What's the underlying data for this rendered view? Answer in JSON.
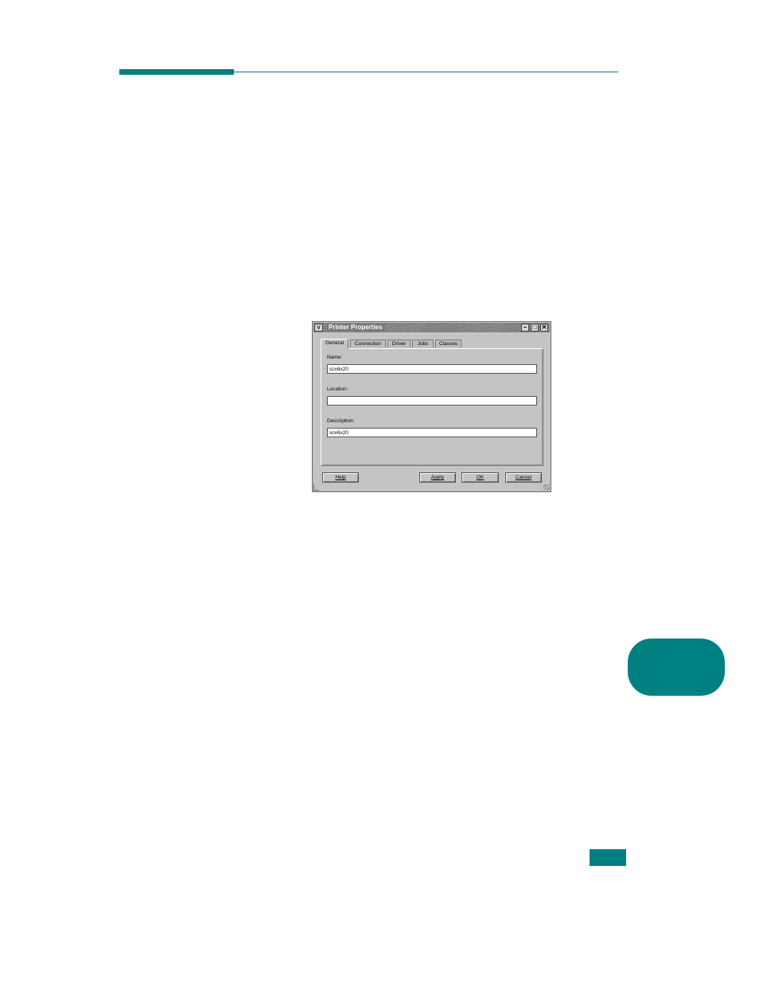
{
  "page": {
    "accent_color": "#008080"
  },
  "dialog": {
    "title": "Printer Properties",
    "window_menu_icon": "chevron-down-icon",
    "minimize_icon": "minimize-icon",
    "maximize_icon": "maximize-icon",
    "close_icon": "close-icon",
    "tabs": [
      {
        "label": "General",
        "active": true
      },
      {
        "label": "Connection",
        "active": false
      },
      {
        "label": "Driver",
        "active": false
      },
      {
        "label": "Jobs",
        "active": false
      },
      {
        "label": "Classes",
        "active": false
      }
    ],
    "fields": {
      "name": {
        "label": "Name:",
        "value": "scx6x20"
      },
      "location": {
        "label": "Location:",
        "value": ""
      },
      "description": {
        "label": "Description:",
        "value": "scx6x20"
      }
    },
    "buttons": {
      "help": "Help",
      "apply": "Apply",
      "ok": "OK",
      "cancel": "Cancel"
    }
  }
}
